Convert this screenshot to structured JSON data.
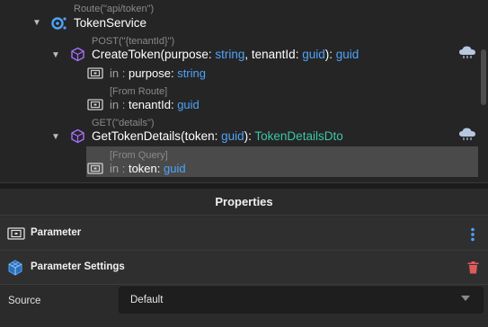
{
  "tree": {
    "service": {
      "annotation": "Route(\"api/token\")",
      "name": "TokenService",
      "icon": "service-icon"
    },
    "operations": [
      {
        "annotation": "POST(\"{tenantId}\")",
        "name": "CreateToken",
        "open_paren": "(",
        "p1_name": "purpose",
        "colon": ": ",
        "p1_type": "string",
        "sep": ", ",
        "p2_name": "tenantId",
        "p2_type": "guid",
        "close": "): ",
        "return_type": "guid",
        "params": [
          {
            "annotation": "",
            "direction": "in",
            "colon": " : ",
            "name": "purpose",
            "type": "string"
          },
          {
            "annotation": "[From Route]",
            "direction": "in",
            "colon": " : ",
            "name": "tenantId",
            "type": "guid"
          }
        ]
      },
      {
        "annotation": "GET(\"details\")",
        "name": "GetTokenDetails",
        "open_paren": "(",
        "p1_name": "token",
        "colon": ": ",
        "p1_type": "guid",
        "close": "): ",
        "return_type": "TokenDetailsDto",
        "params": [
          {
            "annotation": "[From Query]",
            "direction": "in",
            "colon": " : ",
            "name": "token",
            "type": "guid"
          }
        ]
      }
    ]
  },
  "properties": {
    "title": "Properties",
    "sections": [
      {
        "label": "Parameter",
        "icon": "parameter-icon",
        "action_icon": "more-vertical-icon"
      },
      {
        "label": "Parameter Settings",
        "icon": "settings-cube-icon",
        "action_icon": "trash-icon"
      }
    ],
    "field": {
      "label": "Source",
      "value": "Default"
    }
  },
  "colors": {
    "accent_blue": "#4fa3f7",
    "accent_teal": "#3dc7a7",
    "operation_purple": "#a970ff",
    "delete_red": "#e05a5a"
  }
}
